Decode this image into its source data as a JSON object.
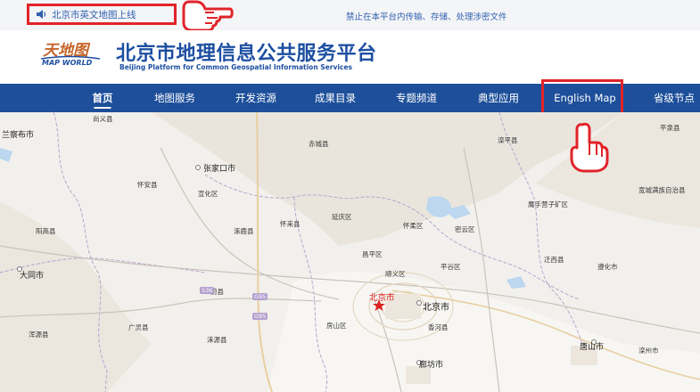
{
  "topbar": {
    "notice": "北京市英文地图上线",
    "warning": "禁止在本平台内传输、存储、处理涉密文件"
  },
  "header": {
    "logo_cn": "天地图",
    "logo_en": "MAP WORLD",
    "title_cn": "北京市地理信息公共服务平台",
    "title_en": "Beijing Platform for Common Geospatial Information Services"
  },
  "nav": {
    "items": [
      "首页",
      "地图服务",
      "开发资源",
      "成果目录",
      "专题频道",
      "典型应用",
      "English Map",
      "省级节点"
    ],
    "active": "首页"
  },
  "map": {
    "places": [
      {
        "name": "尚义县"
      },
      {
        "name": "兰察布市"
      },
      {
        "name": "赤城县"
      },
      {
        "name": "滦平县"
      },
      {
        "name": "平泉县"
      },
      {
        "name": "张家口市"
      },
      {
        "name": "怀安县"
      },
      {
        "name": "宣化区"
      },
      {
        "name": "宽城满族自治县"
      },
      {
        "name": "怀来县"
      },
      {
        "name": "延庆区"
      },
      {
        "name": "怀柔区"
      },
      {
        "name": "密云区"
      },
      {
        "name": "鹰手营子矿区"
      },
      {
        "name": "阳高县"
      },
      {
        "name": "涿鹿县"
      },
      {
        "name": "昌平区"
      },
      {
        "name": "迁西县"
      },
      {
        "name": "大同市"
      },
      {
        "name": "顺义区"
      },
      {
        "name": "平谷区"
      },
      {
        "name": "遵化市"
      },
      {
        "name": "蔚县"
      },
      {
        "name": "北京市"
      },
      {
        "name": "北京市"
      },
      {
        "name": "广灵县"
      },
      {
        "name": "涞源县"
      },
      {
        "name": "房山区"
      },
      {
        "name": "香河县"
      },
      {
        "name": "唐山市"
      },
      {
        "name": "滦州市"
      },
      {
        "name": "浑源县"
      },
      {
        "name": "廊坊市"
      }
    ],
    "roads": [
      "S36",
      "G95",
      "G95"
    ]
  },
  "colors": {
    "nav_bg": "#1d4f9a",
    "title": "#1d4fa1",
    "highlight": "#e0242a"
  }
}
